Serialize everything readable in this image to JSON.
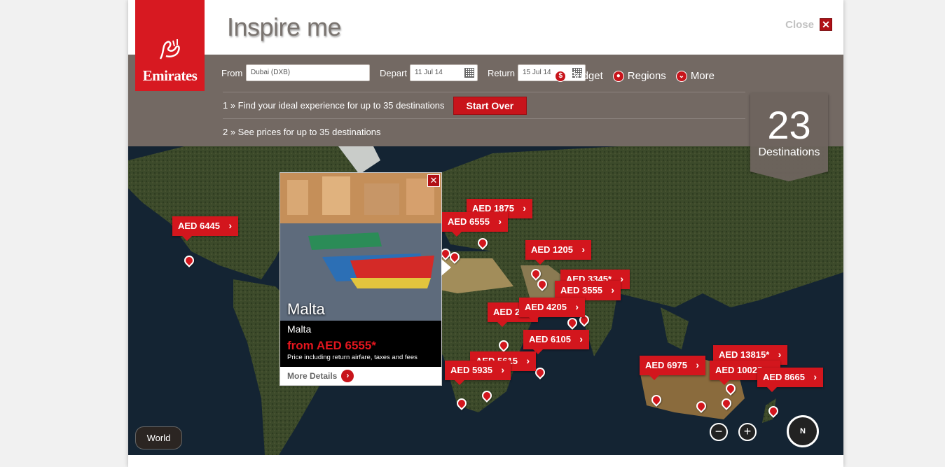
{
  "brand": {
    "name": "Emirates"
  },
  "header": {
    "title": "Inspire me",
    "close_label": "Close"
  },
  "search": {
    "from_label": "From",
    "from_value": "Dubai (DXB)",
    "depart_label": "Depart",
    "depart_value": "11 Jul 14",
    "return_label": "Return",
    "return_value": "15 Jul 14"
  },
  "filters": [
    {
      "label": "Budget",
      "icon": "dollar-icon"
    },
    {
      "label": "Regions",
      "icon": "globe-icon"
    },
    {
      "label": "More",
      "icon": "chevron-down-icon"
    }
  ],
  "steps": {
    "step1": "1 » Find your ideal experience for up to 35 destinations",
    "start_over": "Start Over",
    "step2": "2 » See prices for up to 35 destinations"
  },
  "counter": {
    "number": "23",
    "label": "Destinations"
  },
  "prices": [
    {
      "label": "AED 6445"
    },
    {
      "label": "AED 1875"
    },
    {
      "label": "AED 6555"
    },
    {
      "label": "AED 1205"
    },
    {
      "label": "AED 3345*"
    },
    {
      "label": "AED 3555"
    },
    {
      "label": "AED 2"
    },
    {
      "label": "AED 4205"
    },
    {
      "label": "AED 6105"
    },
    {
      "label": "AED 5615"
    },
    {
      "label": "AED 5935"
    },
    {
      "label": "AED 6975"
    },
    {
      "label": "AED 13815*"
    },
    {
      "label": "AED 10025"
    },
    {
      "label": "AED 8665"
    }
  ],
  "popup": {
    "city": "Malta",
    "country": "Malta",
    "from_price": "from AED 6555*",
    "note": "Price including return airfare, taxes and fees",
    "more": "More Details"
  },
  "map_controls": {
    "world": "World",
    "compass": "N",
    "zoom_out": "−",
    "zoom_in": "+"
  },
  "colors": {
    "brand_red": "#d71921",
    "toolbar": "#675c56"
  }
}
